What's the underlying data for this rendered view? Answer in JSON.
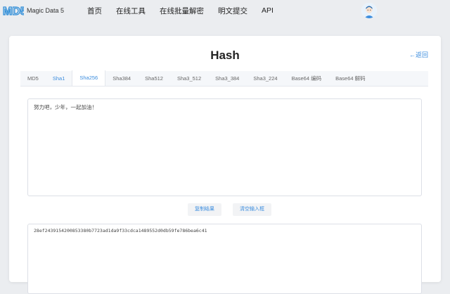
{
  "brand": {
    "logo_text": "MD5",
    "name": "Magic Data 5"
  },
  "nav": [
    "首页",
    "在线工具",
    "在线批量解密",
    "明文提交",
    "API"
  ],
  "page": {
    "title": "Hash",
    "back_label": "←返回"
  },
  "tabs": [
    {
      "label": "MD5"
    },
    {
      "label": "Sha1"
    },
    {
      "label": "Sha256"
    },
    {
      "label": "Sha384"
    },
    {
      "label": "Sha512"
    },
    {
      "label": "Sha3_512"
    },
    {
      "label": "Sha3_384"
    },
    {
      "label": "Sha3_224"
    },
    {
      "label": "Base64 编码"
    },
    {
      "label": "Base64 解码"
    }
  ],
  "input": {
    "value": "努力吧，少年，一起加油！"
  },
  "buttons": {
    "copy": "复制结果",
    "clear": "清空输入框"
  },
  "output": {
    "value": "28ef2439154200853380b7723ad1da9f33cdca1489552d0db59fe786bea6c41"
  },
  "colors": {
    "accent": "#3c8dde",
    "logo": "#2f8ed8"
  },
  "icons": {
    "avatar": "avatar-icon"
  }
}
